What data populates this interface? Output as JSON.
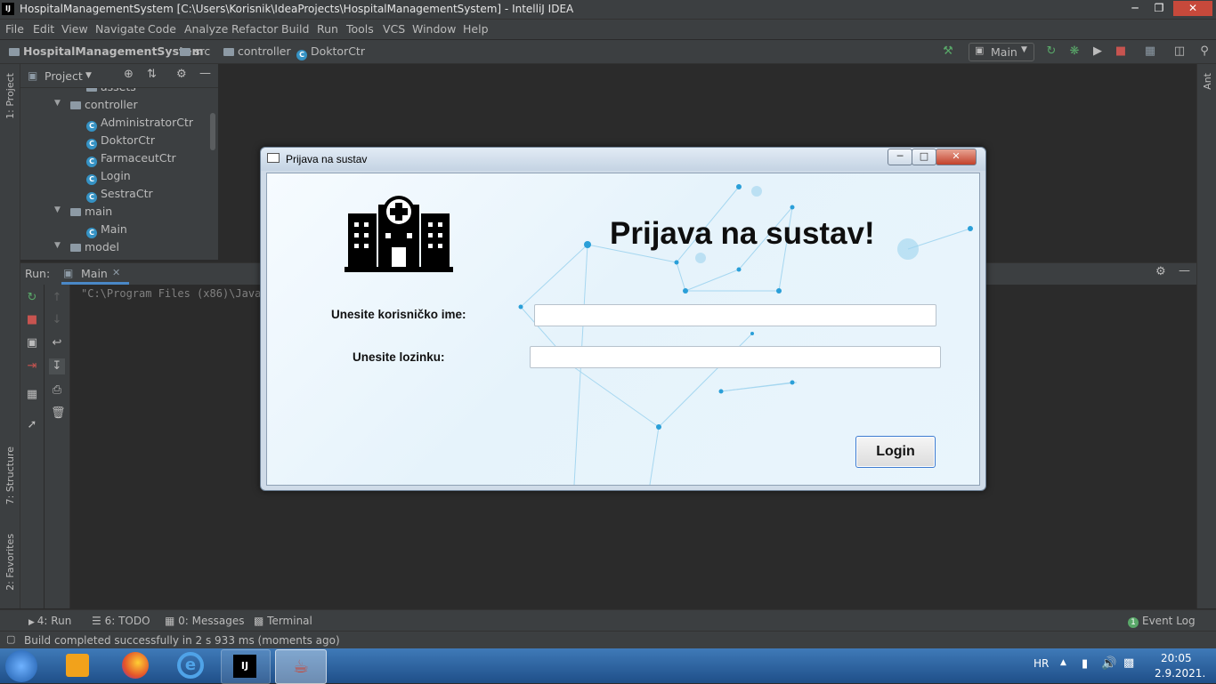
{
  "window": {
    "title": "HospitalManagementSystem [C:\\Users\\Korisnik\\IdeaProjects\\HospitalManagementSystem] - IntelliJ IDEA",
    "logo": "IJ"
  },
  "menu": [
    "File",
    "Edit",
    "View",
    "Navigate",
    "Code",
    "Analyze",
    "Refactor",
    "Build",
    "Run",
    "Tools",
    "VCS",
    "Window",
    "Help"
  ],
  "breadcrumb": {
    "project": "HospitalManagementSystem",
    "src": "src",
    "package": "controller",
    "file": "DoktorCtr"
  },
  "run_config": "Main",
  "project_panel": {
    "title": "Project",
    "items": [
      {
        "label": "assets",
        "type": "folder"
      },
      {
        "label": "controller",
        "type": "folder"
      },
      {
        "label": "AdministratorCtr",
        "type": "class"
      },
      {
        "label": "DoktorCtr",
        "type": "class"
      },
      {
        "label": "FarmaceutCtr",
        "type": "class"
      },
      {
        "label": "Login",
        "type": "class"
      },
      {
        "label": "SestraCtr",
        "type": "class"
      },
      {
        "label": "main",
        "type": "folder"
      },
      {
        "label": "Main",
        "type": "class"
      },
      {
        "label": "model",
        "type": "folder"
      }
    ]
  },
  "left_strip": {
    "project": "1: Project",
    "structure": "7: Structure",
    "favorites": "2: Favorites"
  },
  "right_strip": {
    "ant": "Ant"
  },
  "run_panel": {
    "label": "Run:",
    "tab": "Main",
    "console_line": "\"C:\\Program Files (x86)\\Java"
  },
  "bottom_tabs": {
    "run": "4: Run",
    "todo": "6: TODO",
    "messages": "0: Messages",
    "terminal": "Terminal",
    "event_log": "Event Log",
    "event_count": "1"
  },
  "status": "Build completed successfully in 2 s 933 ms (moments ago)",
  "taskbar": {
    "lang": "HR",
    "time": "20:05",
    "date": "2.9.2021."
  },
  "dialog": {
    "title": "Prijava na sustav",
    "heading": "Prijava na sustav!",
    "username_label": "Unesite korisničko ime:",
    "username_value": "",
    "password_label": "Unesite lozinku:",
    "password_value": "",
    "login_button": "Login"
  },
  "colors": {
    "ide_bg": "#2b2b2b",
    "ide_panel": "#3c3f41",
    "class_icon": "#3592c4",
    "stop_red": "#c75450",
    "run_green": "#59a869",
    "login_border": "#3d7bd0"
  }
}
